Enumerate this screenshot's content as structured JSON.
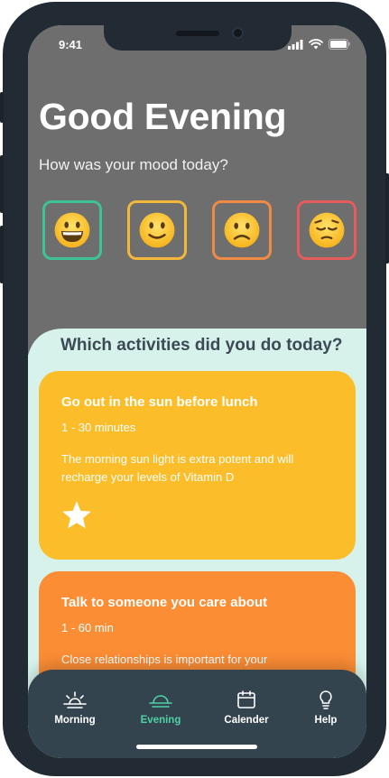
{
  "status": {
    "time": "9:41"
  },
  "header": {
    "greeting": "Good Evening",
    "question": "How was your mood today?"
  },
  "moods": [
    {
      "name": "very-happy",
      "border": "#3ec396",
      "face": "grin"
    },
    {
      "name": "happy",
      "border": "#f3b73a",
      "face": "smile"
    },
    {
      "name": "sad",
      "border": "#f08b46",
      "face": "frown"
    },
    {
      "name": "very-sad",
      "border": "#e65b5b",
      "face": "pensive"
    }
  ],
  "activities": {
    "title": "Which activities did you do today?",
    "cards": [
      {
        "title": "Go out in the sun before lunch",
        "duration": "1 - 30 minutes",
        "description": "The morning sun light is extra potent and will recharge your levels of Vitamin D",
        "color": "#fbbd2a",
        "icon": "star-icon"
      },
      {
        "title": "Talk to someone you care about",
        "duration": "1 - 60 min",
        "description": "Close relationships is important for your mental wellbeing",
        "color": "#fb8d35"
      }
    ]
  },
  "tabs": [
    {
      "label": "Morning",
      "icon": "sunrise-icon",
      "active": false
    },
    {
      "label": "Evening",
      "icon": "sunset-icon",
      "active": true
    },
    {
      "label": "Calender",
      "icon": "calendar-icon",
      "active": false
    },
    {
      "label": "Help",
      "icon": "lightbulb-icon",
      "active": false
    }
  ],
  "colors": {
    "header_bg": "#6e6e6e",
    "content_bg": "#d6f2ea",
    "tabbar_bg": "#33444f",
    "accent": "#4fd1a5"
  }
}
